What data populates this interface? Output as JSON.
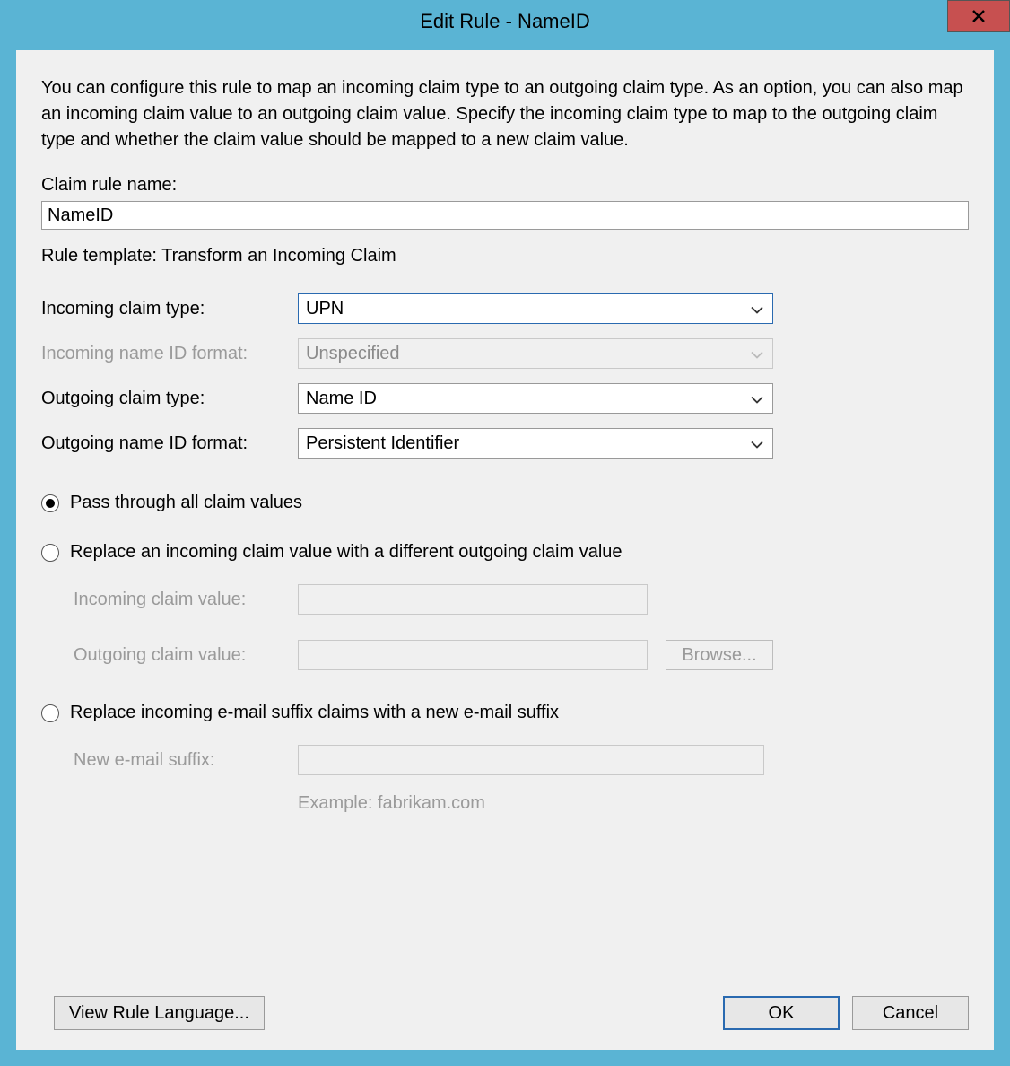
{
  "titlebar": {
    "title": "Edit Rule - NameID"
  },
  "main": {
    "description": "You can configure this rule to map an incoming claim type to an outgoing claim type. As an option, you can also map an incoming claim value to an outgoing claim value. Specify the incoming claim type to map to the outgoing claim type and whether the claim value should be mapped to a new claim value.",
    "claim_rule_name_label": "Claim rule name:",
    "claim_rule_name_value": "NameID",
    "template_label_prefix": "Rule template: ",
    "template_name": "Transform an Incoming Claim",
    "incoming_type_label": "Incoming claim type:",
    "incoming_type_value": "UPN",
    "incoming_nameid_label": "Incoming name ID format:",
    "incoming_nameid_value": "Unspecified",
    "outgoing_type_label": "Outgoing claim type:",
    "outgoing_type_value": "Name ID",
    "outgoing_nameid_label": "Outgoing name ID format:",
    "outgoing_nameid_value": "Persistent Identifier",
    "radio_passthrough": "Pass through all claim values",
    "radio_replace_value": "Replace an incoming claim value with a different outgoing claim value",
    "incoming_value_label": "Incoming claim value:",
    "outgoing_value_label": "Outgoing claim value:",
    "browse_label": "Browse...",
    "radio_replace_suffix": "Replace incoming e-mail suffix claims with a new e-mail suffix",
    "new_suffix_label": "New e-mail suffix:",
    "example_text": "Example: fabrikam.com"
  },
  "footer": {
    "view_rule_language": "View Rule Language...",
    "ok": "OK",
    "cancel": "Cancel"
  }
}
